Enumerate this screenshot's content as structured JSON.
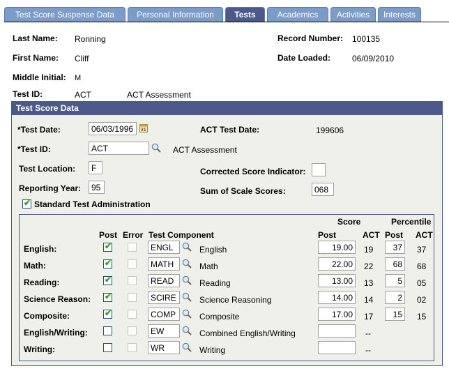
{
  "tabs": [
    {
      "label": "Test Score Suspense Data",
      "active": false
    },
    {
      "label": "Personal Information",
      "active": false
    },
    {
      "label": "Tests",
      "active": true
    },
    {
      "label": "Academics",
      "active": false
    },
    {
      "label": "Activities",
      "active": false
    },
    {
      "label": "Interests",
      "active": false
    }
  ],
  "header": {
    "last_name_label": "Last Name:",
    "last_name": "Ronning",
    "first_name_label": "First Name:",
    "first_name": "Cliff",
    "middle_initial_label": "Middle Initial:",
    "middle_initial": "M",
    "test_id_label": "Test ID:",
    "test_id": "ACT",
    "test_id_desc": "ACT Assessment",
    "record_number_label": "Record Number:",
    "record_number": "100135",
    "date_loaded_label": "Date Loaded:",
    "date_loaded": "06/09/2010"
  },
  "section": {
    "title": "Test Score Data",
    "test_date_label": "*Test Date:",
    "test_date": "06/03/1996",
    "act_test_date_label": "ACT Test Date:",
    "act_test_date": "199606",
    "test_id_label": "*Test ID:",
    "test_id": "ACT",
    "test_id_desc": "ACT Assessment",
    "test_location_label": "Test Location:",
    "test_location": "F",
    "corrected_label": "Corrected Score Indicator:",
    "corrected": "",
    "reporting_year_label": "Reporting Year:",
    "reporting_year": "95",
    "sum_label": "Sum of Scale Scores:",
    "sum": "068",
    "standard_label": "Standard Test Administration",
    "standard_checked": true
  },
  "grid": {
    "headers": {
      "score": "Score",
      "percentile": "Percentile",
      "post": "Post",
      "error": "Error",
      "component": "Test Component",
      "score_post": "Post",
      "score_act": "ACT",
      "pct_post": "Post",
      "pct_act": "ACT"
    },
    "rows": [
      {
        "label": "English:",
        "post": true,
        "code": "ENGL",
        "desc": "English",
        "score_post": "19.00",
        "score_act": "19",
        "pct_post": "37",
        "pct_act": "37"
      },
      {
        "label": "Math:",
        "post": true,
        "code": "MATH",
        "desc": "Math",
        "score_post": "22.00",
        "score_act": "22",
        "pct_post": "68",
        "pct_act": "68"
      },
      {
        "label": "Reading:",
        "post": true,
        "code": "READ",
        "desc": "Reading",
        "score_post": "13.00",
        "score_act": "13",
        "pct_post": "5",
        "pct_act": "05"
      },
      {
        "label": "Science Reason:",
        "post": true,
        "code": "SCIRE",
        "desc": "Science Reasoning",
        "score_post": "14.00",
        "score_act": "14",
        "pct_post": "2",
        "pct_act": "02"
      },
      {
        "label": "Composite:",
        "post": true,
        "code": "COMP",
        "desc": "Composite",
        "score_post": "17.00",
        "score_act": "17",
        "pct_post": "15",
        "pct_act": "15"
      },
      {
        "label": "English/Writing:",
        "post": false,
        "code": "EW",
        "desc": "Combined English/Writing",
        "score_post": "",
        "score_act": "--",
        "pct_post": null,
        "pct_act": ""
      },
      {
        "label": "Writing:",
        "post": false,
        "code": "WR",
        "desc": "Writing",
        "score_post": "",
        "score_act": "--",
        "pct_post": null,
        "pct_act": ""
      }
    ]
  }
}
